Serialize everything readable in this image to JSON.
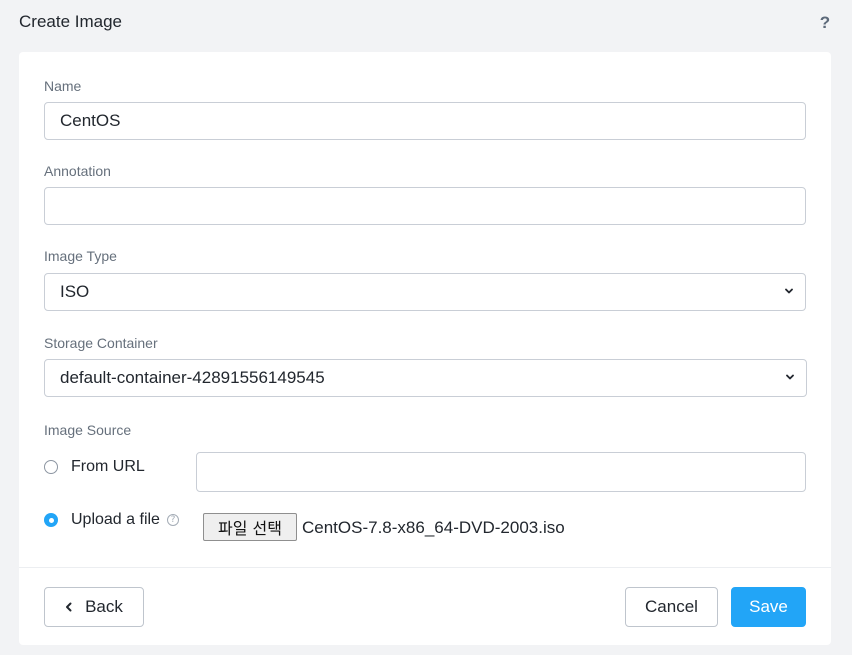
{
  "dialog": {
    "title": "Create Image",
    "help_icon": "help-icon",
    "help_symbol": "?"
  },
  "form": {
    "name": {
      "label": "Name",
      "value": "CentOS"
    },
    "annotation": {
      "label": "Annotation",
      "value": ""
    },
    "image_type": {
      "label": "Image Type",
      "selected": "ISO"
    },
    "storage_container": {
      "label": "Storage Container",
      "selected": "default-container-42891556149545"
    },
    "image_source": {
      "label": "Image Source",
      "from_url": {
        "label": "From URL",
        "checked": false,
        "value": ""
      },
      "upload_file": {
        "label": "Upload a file",
        "checked": true,
        "info_icon": "info-icon",
        "info_symbol": "?",
        "choose_button_label": "파일 선택",
        "file_name": "CentOS-7.8-x86_64-DVD-2003.iso"
      }
    }
  },
  "footer": {
    "back_label": "Back",
    "cancel_label": "Cancel",
    "save_label": "Save"
  },
  "colors": {
    "accent": "#22a5f7",
    "background": "#f2f3f5",
    "text": "#22272e",
    "label": "#66707c"
  }
}
